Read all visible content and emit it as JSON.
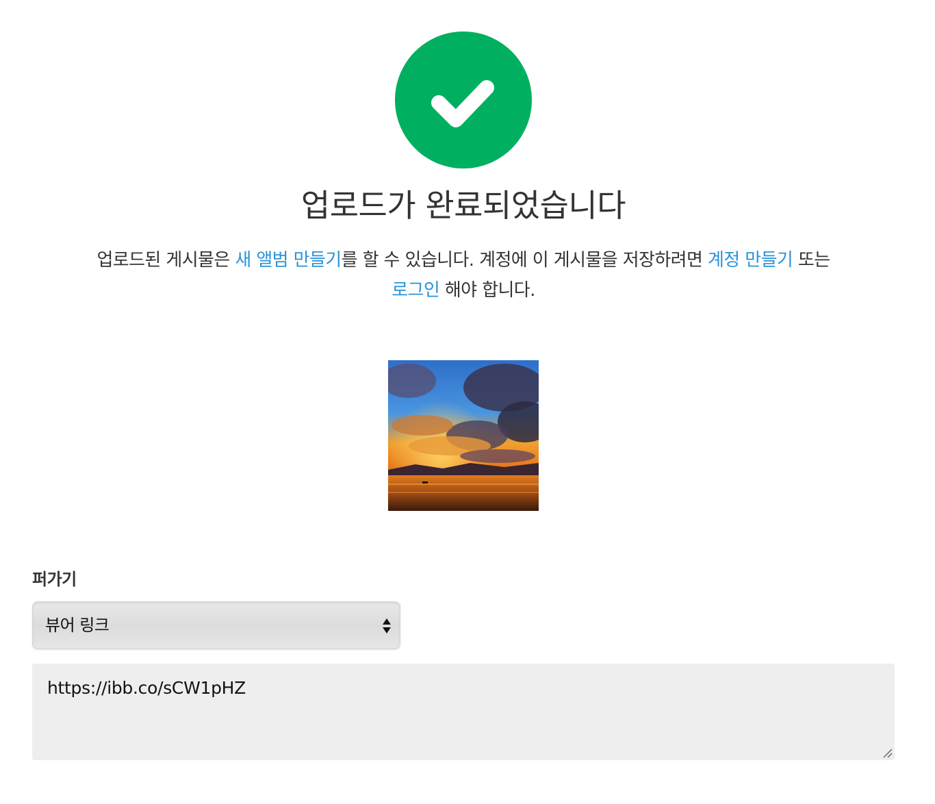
{
  "status": {
    "icon": "checkmark-icon",
    "icon_color": "#00af5f",
    "title": "업로드가 완료되었습니다"
  },
  "message": {
    "part1": "업로드된 게시물은 ",
    "link_album": "새 앨범 만들기",
    "part2": "를 할 수 있습니다. 계정에 이 게시물을 저장하려면 ",
    "link_signup": "계정 만들기",
    "part3": " 또는 ",
    "link_login": "로그인",
    "part4": " 해야 합니다.",
    "link_color": "#2a93d5"
  },
  "embed": {
    "label": "퍼가기",
    "selected_option": "뷰어 링크",
    "link_value": "https://ibb.co/sCW1pHZ"
  }
}
